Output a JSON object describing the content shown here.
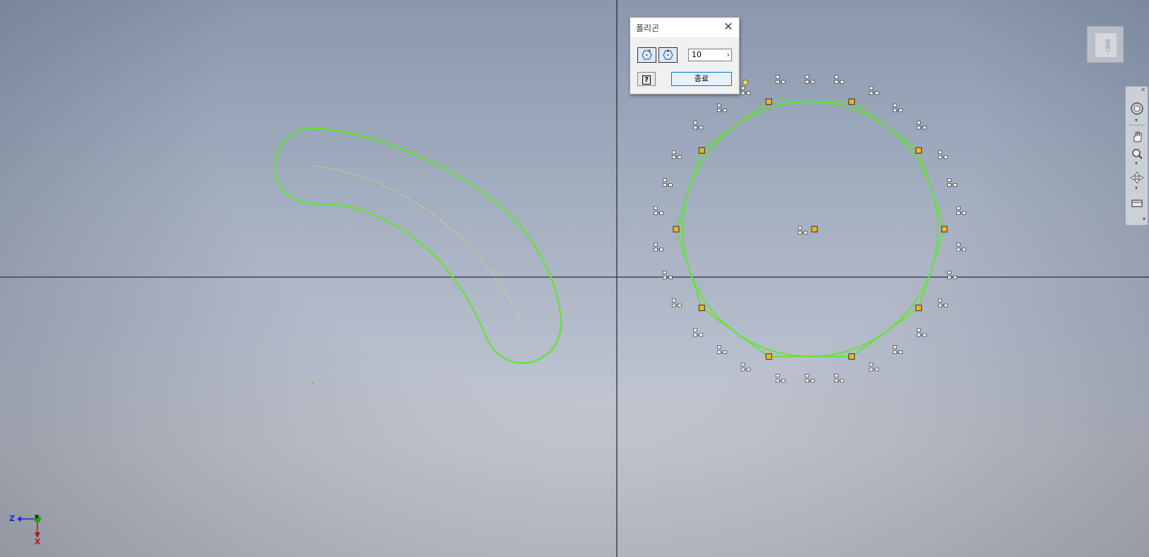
{
  "dialog": {
    "title": "폴리곤",
    "close_icon": "close-icon",
    "mode_inscribed_icon": "polygon-inscribed-icon",
    "mode_circumscribed_icon": "polygon-circumscribed-icon",
    "sides_value": "10",
    "help_icon": "help-icon",
    "help_text": "?",
    "finish_label": "종료"
  },
  "viewcube": {
    "face_label": "앞면"
  },
  "triad": {
    "z_label": "Z",
    "y_label": "Y",
    "x_label": "X"
  },
  "colors": {
    "sketch_curve": "#5ee62d",
    "constraint_point": "#f4b224",
    "crosshair": "#2d2f36",
    "finish_border": "#0078d7"
  },
  "navbar_icons": [
    "close-icon",
    "steering-wheel-icon",
    "pan-icon",
    "zoom-icon",
    "orbit-icon",
    "look-at-icon"
  ]
}
